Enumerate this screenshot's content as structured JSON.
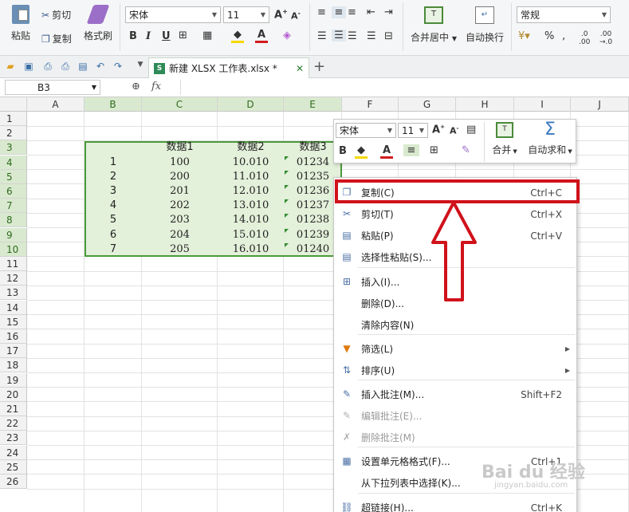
{
  "ribbon": {
    "paste": "粘贴",
    "cut": "剪切",
    "copy": "复制",
    "format_painter": "格式刷",
    "font_name": "宋体",
    "font_size": "11",
    "merge_center": "合并居中",
    "wrap_text": "自动换行",
    "number_format": "常规",
    "percent": "%"
  },
  "tabbar": {
    "doc_title": "新建 XLSX 工作表.xlsx *"
  },
  "formula_bar": {
    "name_box": "B3",
    "fx": "fx"
  },
  "columns": [
    "A",
    "B",
    "C",
    "D",
    "E",
    "F",
    "G",
    "H",
    "I",
    "J"
  ],
  "selected_columns": [
    "B",
    "C",
    "D",
    "E"
  ],
  "rows": [
    "1",
    "2",
    "3",
    "4",
    "5",
    "6",
    "7",
    "8",
    "9",
    "10",
    "11",
    "12",
    "13",
    "14",
    "15",
    "16",
    "17",
    "18",
    "19",
    "20",
    "21",
    "22",
    "23",
    "24",
    "25",
    "26"
  ],
  "selected_rows": [
    "3",
    "4",
    "5",
    "6",
    "7",
    "8",
    "9",
    "10"
  ],
  "table": {
    "headers": [
      "",
      "数据1",
      "数据2",
      "数据3"
    ],
    "rows": [
      [
        "1",
        "100",
        "10.010",
        "01234"
      ],
      [
        "2",
        "200",
        "11.010",
        "01235"
      ],
      [
        "3",
        "201",
        "12.010",
        "01236"
      ],
      [
        "4",
        "202",
        "13.010",
        "01237"
      ],
      [
        "5",
        "203",
        "14.010",
        "01238"
      ],
      [
        "6",
        "204",
        "15.010",
        "01239"
      ],
      [
        "7",
        "205",
        "16.010",
        "01240"
      ]
    ]
  },
  "mini_toolbar": {
    "font_name": "宋体",
    "font_size": "11",
    "merge": "合并",
    "autosum": "自动求和"
  },
  "context_menu": {
    "items": [
      {
        "label": "复制(C)",
        "shortcut": "Ctrl+C",
        "icon": "copy-icon"
      },
      {
        "label": "剪切(T)",
        "shortcut": "Ctrl+X",
        "icon": "scissors-icon"
      },
      {
        "label": "粘贴(P)",
        "shortcut": "Ctrl+V",
        "icon": "paste-icon"
      },
      {
        "label": "选择性粘贴(S)...",
        "shortcut": "",
        "icon": "paste-special-icon"
      },
      {
        "label": "插入(I)...",
        "shortcut": "",
        "icon": "insert-icon"
      },
      {
        "label": "删除(D)...",
        "shortcut": "",
        "icon": ""
      },
      {
        "label": "清除内容(N)",
        "shortcut": "",
        "icon": ""
      },
      {
        "label": "筛选(L)",
        "shortcut": "",
        "icon": "filter-icon"
      },
      {
        "label": "排序(U)",
        "shortcut": "",
        "icon": "sort-icon"
      },
      {
        "label": "插入批注(M)...",
        "shortcut": "Shift+F2",
        "icon": "comment-icon"
      },
      {
        "label": "编辑批注(E)...",
        "shortcut": "",
        "icon": "edit-comment-icon"
      },
      {
        "label": "删除批注(M)",
        "shortcut": "",
        "icon": "delete-comment-icon"
      },
      {
        "label": "设置单元格格式(F)...",
        "shortcut": "Ctrl+1",
        "icon": "format-cells-icon"
      },
      {
        "label": "从下拉列表中选择(K)...",
        "shortcut": "",
        "icon": ""
      },
      {
        "label": "超链接(H)...",
        "shortcut": "Ctrl+K",
        "icon": "hyperlink-icon"
      }
    ]
  },
  "watermark": {
    "text": "Bai du 经验",
    "sub": "jingyan.baidu.com"
  },
  "colors": {
    "highlight": "#d0121b",
    "selection_fill": "#e3f0da",
    "selection_border": "#4a9a3a"
  }
}
